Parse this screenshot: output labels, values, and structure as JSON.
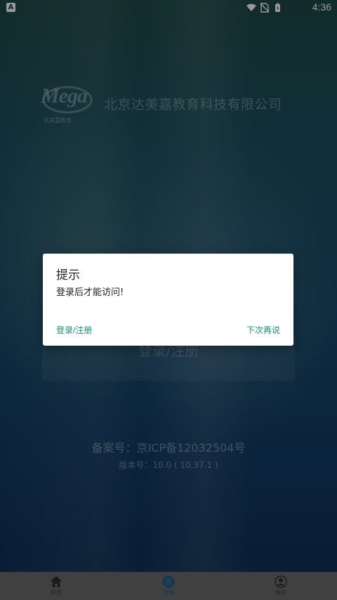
{
  "status_bar": {
    "left_icon": "A",
    "time": "4:36",
    "icons": [
      "wifi-icon",
      "no-sim-icon",
      "battery-icon"
    ]
  },
  "header": {
    "logo_text": "Mega",
    "logo_subtext": "达美嘉教育",
    "company_name": "北京达美嘉教育科技有限公司"
  },
  "main": {
    "login_button": "登录/注册",
    "icp": "备案号：京ICP备12032504号",
    "version": "版本号：10.0 ( 10.37.1 )"
  },
  "dialog": {
    "title": "提示",
    "message": "登录后才能访问!",
    "positive_button": "登录/注册",
    "negative_button": "下次再说"
  },
  "bottom_nav": {
    "items": [
      {
        "label": "首页",
        "icon": "home-icon",
        "active": false
      },
      {
        "label": "学情",
        "icon": "list-icon",
        "active": true
      },
      {
        "label": "我的",
        "icon": "profile-icon",
        "active": false
      }
    ]
  },
  "colors": {
    "accent": "#1f8a7a",
    "nav_active": "#1f5e8a",
    "nav_background": "#6b6b6b"
  }
}
